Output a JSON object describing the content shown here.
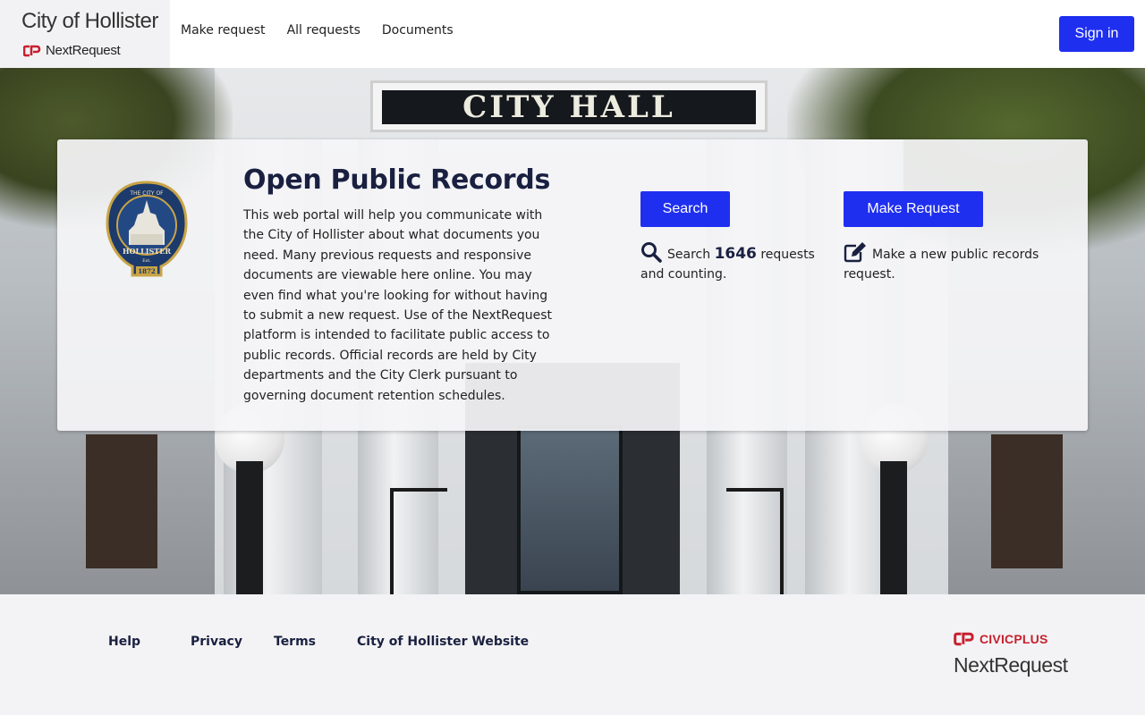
{
  "header": {
    "brand_city": "City of Hollister",
    "brand_product": "NextRequest",
    "nav": [
      "Make request",
      "All requests",
      "Documents"
    ],
    "signin_label": "Sign in"
  },
  "hero": {
    "sign_text": "CITY HALL",
    "card": {
      "title": "Open Public Records",
      "body": "This web portal will help you communicate with the City of Hollister about what documents you need. Many previous requests and responsive documents are viewable here online. You may even find what you're looking for without having to submit a new request. Use of the NextRequest platform is intended to facilitate public access to public records. Official records are held by City departments and the City Clerk pursuant to governing document retention schedules.",
      "search_button": "Search",
      "search_prefix": "Search",
      "request_count": "1646",
      "search_suffix": "requests and counting.",
      "make_button": "Make Request",
      "make_info": "Make a new public records request."
    },
    "seal": {
      "top_text": "THE CITY OF",
      "bottom_text": "HOLLISTER",
      "est": "Est.",
      "year": "1872"
    }
  },
  "footer": {
    "links": [
      "Help",
      "Privacy",
      "Terms",
      "City of Hollister Website"
    ],
    "civicplus": "CIVICPLUS",
    "nextrequest": "NextRequest"
  },
  "colors": {
    "accent": "#1f2ff0",
    "title": "#1a2040",
    "brand_red": "#c8202f"
  },
  "icons": [
    "nextrequest-logo-icon",
    "city-seal-icon",
    "search-icon",
    "edit-icon",
    "civicplus-logo-icon"
  ]
}
